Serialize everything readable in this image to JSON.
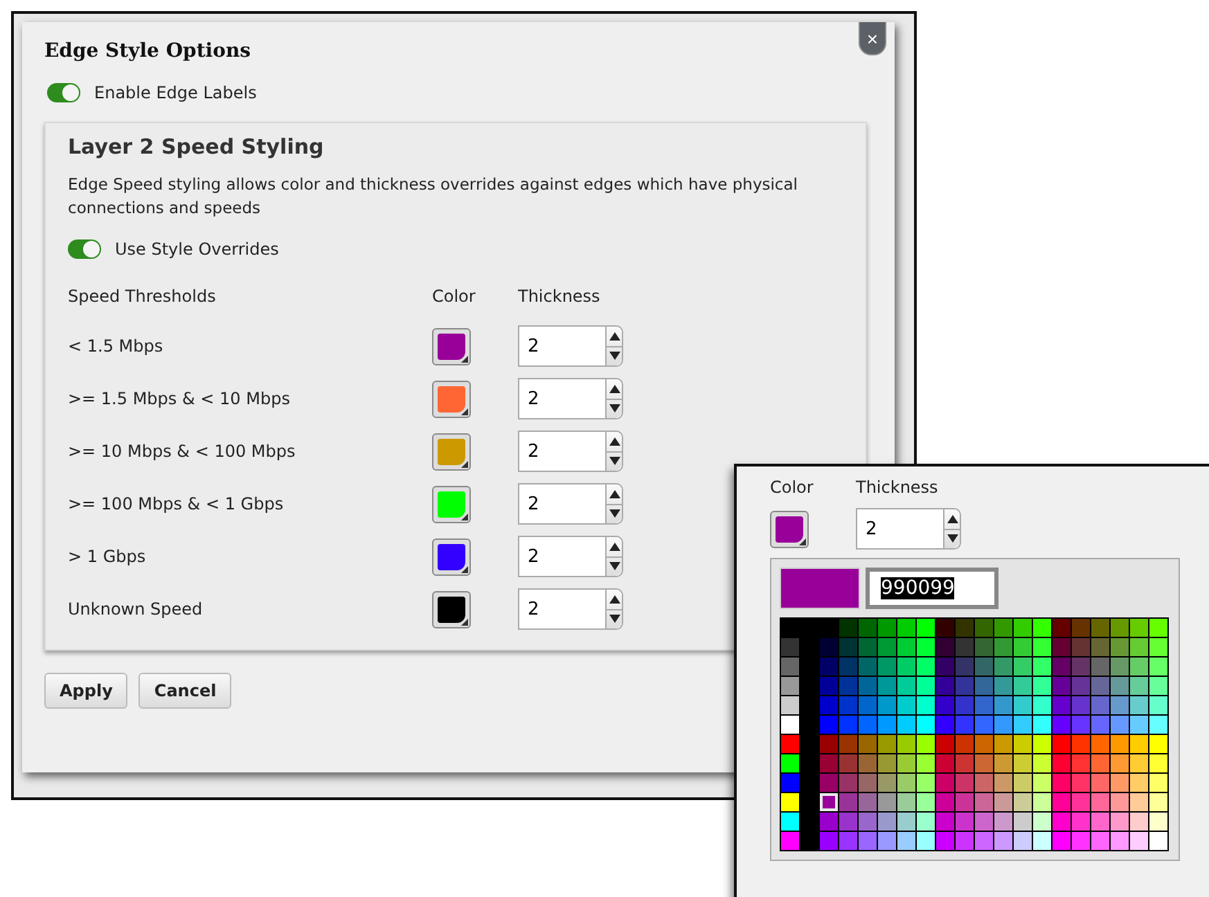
{
  "dialog": {
    "title": "Edge Style Options",
    "close": "×",
    "enable_labels": {
      "label": "Enable Edge Labels",
      "on": true
    },
    "section": {
      "title": "Layer 2 Speed Styling",
      "description": "Edge Speed styling allows color and thickness overrides against edges which have physical connections and speeds",
      "overrides": {
        "label": "Use Style Overrides",
        "on": true
      },
      "columns": [
        "Speed Thresholds",
        "Color",
        "Thickness"
      ],
      "rows": [
        {
          "threshold": "< 1.5 Mbps",
          "color": "#990099",
          "thickness": "2"
        },
        {
          "threshold": ">= 1.5 Mbps & < 10 Mbps",
          "color": "#ff6633",
          "thickness": "2"
        },
        {
          "threshold": ">= 10 Mbps & < 100 Mbps",
          "color": "#cc9900",
          "thickness": "2"
        },
        {
          "threshold": ">= 100 Mbps & < 1 Gbps",
          "color": "#00ff00",
          "thickness": "2"
        },
        {
          "threshold": "> 1 Gbps",
          "color": "#3300ff",
          "thickness": "2"
        },
        {
          "threshold": "Unknown Speed",
          "color": "#000000",
          "thickness": "2"
        }
      ]
    },
    "buttons": [
      "Apply",
      "Cancel"
    ]
  },
  "picker_inset": {
    "columns": [
      "Color",
      "Thickness"
    ],
    "thickness": "2",
    "hex": "990099"
  }
}
